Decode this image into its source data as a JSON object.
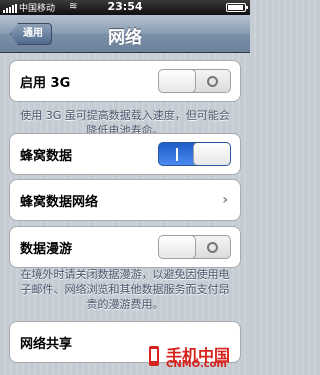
{
  "status_bar": {
    "carrier": "中国移动",
    "network_icon": "wifi-icon",
    "time": "23:54"
  },
  "nav": {
    "back_label": "通用",
    "title": "网络"
  },
  "settings": {
    "enable_3g": {
      "label": "启用 3G",
      "state": "off"
    },
    "enable_3g_note": "使用 3G 虽可提高数据载入速度，但可能会降低电池寿命。",
    "cellular_data": {
      "label": "蜂窝数据",
      "state": "on"
    },
    "cellular_network": {
      "label": "蜂窝数据网络"
    },
    "data_roaming": {
      "label": "数据漫游",
      "state": "off"
    },
    "data_roaming_note": "在境外时请关闭数据漫游，以避免因使用电子邮件、网络浏览和其他数据服务而支付昂贵的漫游费用。",
    "tethering": {
      "label": "网络共享"
    }
  },
  "watermark": {
    "main": "手机中国",
    "sub": "CNMO.com"
  },
  "colors": {
    "switch_on": "#2b6ee0",
    "nav_bar": "#7c8fa8",
    "watermark": "#d6231d"
  }
}
